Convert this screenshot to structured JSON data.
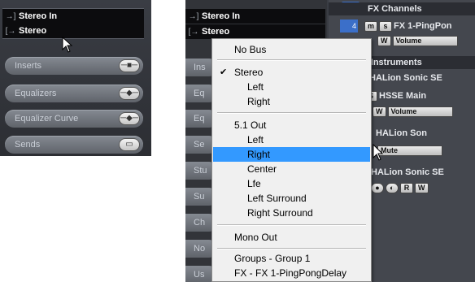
{
  "left_panel": {
    "input_label": "Stereo In",
    "output_label": "Stereo",
    "input_icon": "→]",
    "output_icon": "[→",
    "sections": [
      {
        "label": "Inserts",
        "icon": "insert-routing-icon",
        "glyph": "─■─"
      },
      {
        "label": "Equalizers",
        "icon": "eq-diamond-icon",
        "glyph": "─◆─"
      },
      {
        "label": "Equalizer Curve",
        "icon": "eq-curve-diamond-icon",
        "glyph": "─◆─"
      },
      {
        "label": "Sends",
        "icon": "sends-icon",
        "glyph": "▭"
      }
    ]
  },
  "right_panel": {
    "input_label": "Stereo In",
    "output_label": "Stereo",
    "section_abbrevs": [
      "Ins",
      "Eq",
      "Eq",
      "Se",
      "Stu",
      "Su",
      "Ch",
      "No",
      "Us"
    ],
    "headers": {
      "fx_channels": "FX Channels",
      "instruments": "T Instruments"
    },
    "channels": {
      "fx1_name": "FX 1-PingPon",
      "fx1_param": "Volume",
      "halion_name": "HALion Sonic SE",
      "hsse_name": "HSSE Main",
      "hsse_param": "Volume",
      "halion_son": "HALion Son",
      "mute_param": "Mute",
      "halion_sonic_se2": "HALion Sonic SE"
    },
    "buttons": {
      "m": "m",
      "s": "s",
      "s_upper": "S",
      "w": "W",
      "r": "R",
      "num4": "4"
    }
  },
  "menu": {
    "items": [
      {
        "label": "No Bus"
      },
      {
        "label": "Stereo",
        "checked": true
      },
      {
        "label": "Left",
        "sub": true
      },
      {
        "label": "Right",
        "sub": true
      },
      {
        "label": "5.1 Out"
      },
      {
        "label": "Left",
        "sub": true
      },
      {
        "label": "Right",
        "sub": true,
        "highlighted": true
      },
      {
        "label": "Center",
        "sub": true
      },
      {
        "label": "Lfe",
        "sub": true
      },
      {
        "label": "Left Surround",
        "sub": true
      },
      {
        "label": "Right Surround",
        "sub": true
      },
      {
        "label": "Mono Out"
      },
      {
        "label": "Groups - Group 1"
      },
      {
        "label": "FX - FX 1-PingPongDelay"
      }
    ],
    "check_glyph": "✔"
  },
  "colors": {
    "highlight": "#3399ff",
    "panel_dark": "#2c2e33",
    "section_grey": "#7a7f87",
    "fx_blue": "#3b6fc9"
  }
}
